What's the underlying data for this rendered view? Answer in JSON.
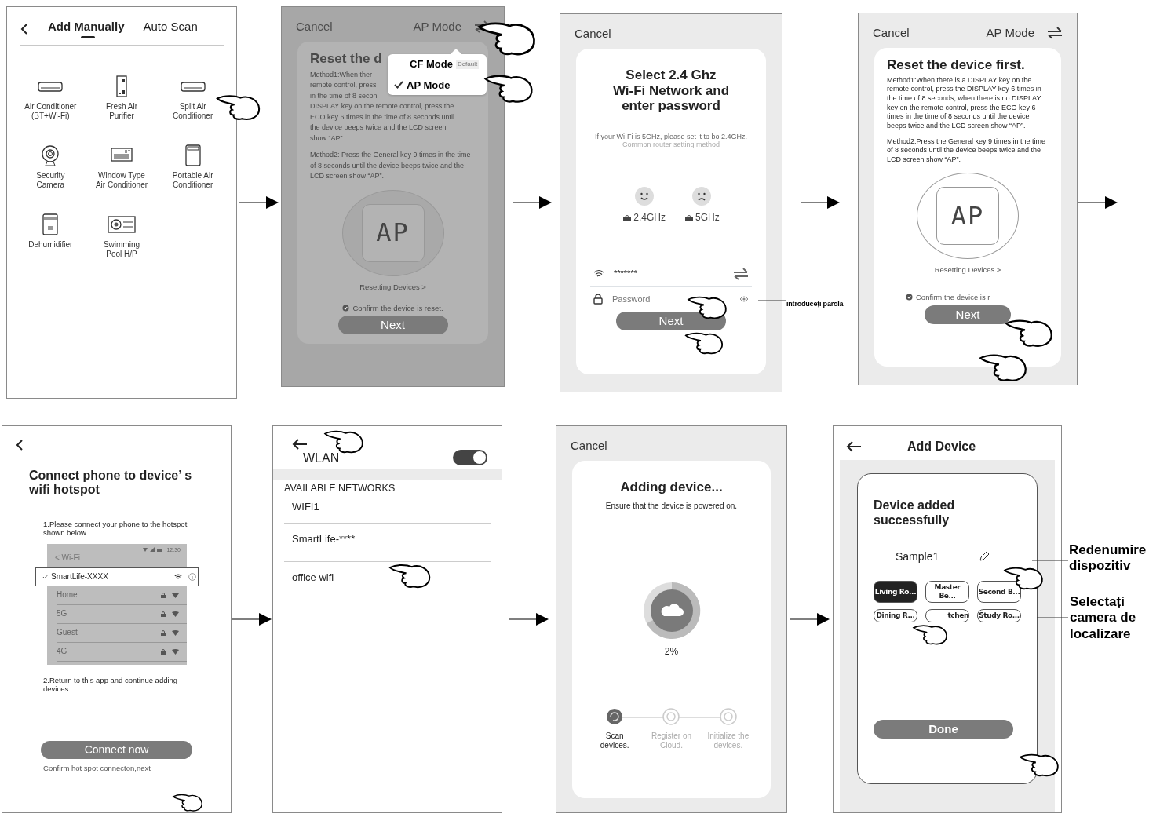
{
  "device_type_screen": {
    "tabs": [
      {
        "label": "Add Manually",
        "selected": true
      },
      {
        "label": "Auto Scan",
        "selected": false
      }
    ],
    "devices": [
      {
        "kind": "split_ac",
        "label": "Air Conditioner\n(BT+Wi-Fi)"
      },
      {
        "kind": "purifier",
        "label": "Fresh Air\nPurifier"
      },
      {
        "kind": "split_ac",
        "label": "Split Air\nConditioner"
      },
      {
        "kind": "camera",
        "label": "Security\nCamera"
      },
      {
        "kind": "window_ac",
        "label": "Window Type\nAir Conditioner"
      },
      {
        "kind": "portable_ac",
        "label": "Portable Air\nConditioner"
      },
      {
        "kind": "dehumidifier",
        "label": "Dehumidifier"
      },
      {
        "kind": "pool",
        "label": "Swimming\nPool H/P"
      }
    ]
  },
  "mode_menu_screen": {
    "cancel": "Cancel",
    "mode": "AP Mode",
    "title": "Reset the d",
    "lines": [
      "Method1:When ther",
      "remote control, press",
      "in the time of 8 secon",
      "DISPLAY key on the remote control, press the",
      "ECO key 6 times in the time of 8 seconds until",
      "the device beeps twice and the LCD screen",
      "show “AP”."
    ],
    "method2": "Method2: Press the General key 9 times in the time of 8 seconds until the device beeps twice and the LCD screen show “AP”.",
    "display": "AP",
    "resetting_link": "Resetting Devices >",
    "confirm": "Confirm the device is reset.",
    "next": "Next",
    "menu": [
      {
        "label": "CF Mode",
        "badge": "Default",
        "selected": false
      },
      {
        "label": "AP Mode",
        "selected": true
      }
    ]
  },
  "wifi_screen": {
    "cancel": "Cancel",
    "title": "Select 2.4 Ghz\nWi-Fi Network and\nenter password",
    "hint": "If your Wi-Fi is 5GHz, please set it to bo 2.4GHz.",
    "hint_link": "Common router setting method",
    "bands": [
      {
        "label": "2.4GHz",
        "supported": true
      },
      {
        "label": "5GHz",
        "supported": false
      }
    ],
    "wifi_name": "*******",
    "password_placeholder": "Password",
    "next": "Next",
    "annotation": "introduceți parola"
  },
  "reset_screen": {
    "cancel": "Cancel",
    "mode": "AP Mode",
    "title": "Reset the device first.",
    "method1": "Method1:When there is a DISPLAY key on the remote control, press the DISPLAY key 6 times in the time of 8 seconds; when there is no DISPLAY key on the remote control, press the ECO key 6 times in the time of 8 seconds until the device beeps twice and the LCD screen show “AP”.",
    "method2": "Method2:Press the General key 9 times in the time of 8 seconds until the device beeps twice and the LCD screen show “AP”.",
    "display": "AP",
    "resetting_link": "Resetting Devices >",
    "confirm": "Confirm the device is r",
    "next": "Next"
  },
  "hotspot_screen": {
    "title": "Connect phone to device’ s\nwifi hotspot",
    "step1": "1.Please connect your phone to the hotspot\nshown below",
    "phone": {
      "time": "12:30",
      "back": "< Wi-Fi",
      "networks": [
        {
          "name": "SmartLife-XXXX",
          "selected": true
        },
        {
          "name": "Home",
          "selected": false
        },
        {
          "name": "5G",
          "selected": false
        },
        {
          "name": "Guest",
          "selected": false
        },
        {
          "name": "4G",
          "selected": false
        }
      ]
    },
    "step2": "2.Return to this app and continue adding\ndevices",
    "button": "Connect now",
    "footer": "Confirm hot spot connecton,next"
  },
  "wlan_screen": {
    "title": "WLAN",
    "on": true,
    "section": "AVAILABLE NETWORKS",
    "networks": [
      "WIFI1",
      "SmartLife-****",
      "office wifi"
    ]
  },
  "adding_screen": {
    "cancel": "Cancel",
    "title": "Adding device...",
    "subtitle": "Ensure that the device is powered on.",
    "percent": "2%",
    "steps": [
      {
        "label": "Scan\ndevices.",
        "active": true
      },
      {
        "label": "Register on\nCloud.",
        "active": false
      },
      {
        "label": "Initialize the\ndevices.",
        "active": false
      }
    ]
  },
  "added_screen": {
    "title": "Add Device",
    "message": "Device added\nsuccessfully",
    "device_name": "Sample1",
    "rooms": [
      {
        "label": "Living Ro...",
        "selected": true
      },
      {
        "label": "Master Be...",
        "selected": false
      },
      {
        "label": "Second B...",
        "selected": false
      },
      {
        "label": "Dining R...",
        "selected": false
      },
      {
        "label": "tchen",
        "selected": false
      },
      {
        "label": "Study Ro...",
        "selected": false
      }
    ],
    "done": "Done",
    "annotations": [
      "Redenumire\ndispozitiv",
      "Selectați\ncamera de\nlocalizare"
    ]
  }
}
